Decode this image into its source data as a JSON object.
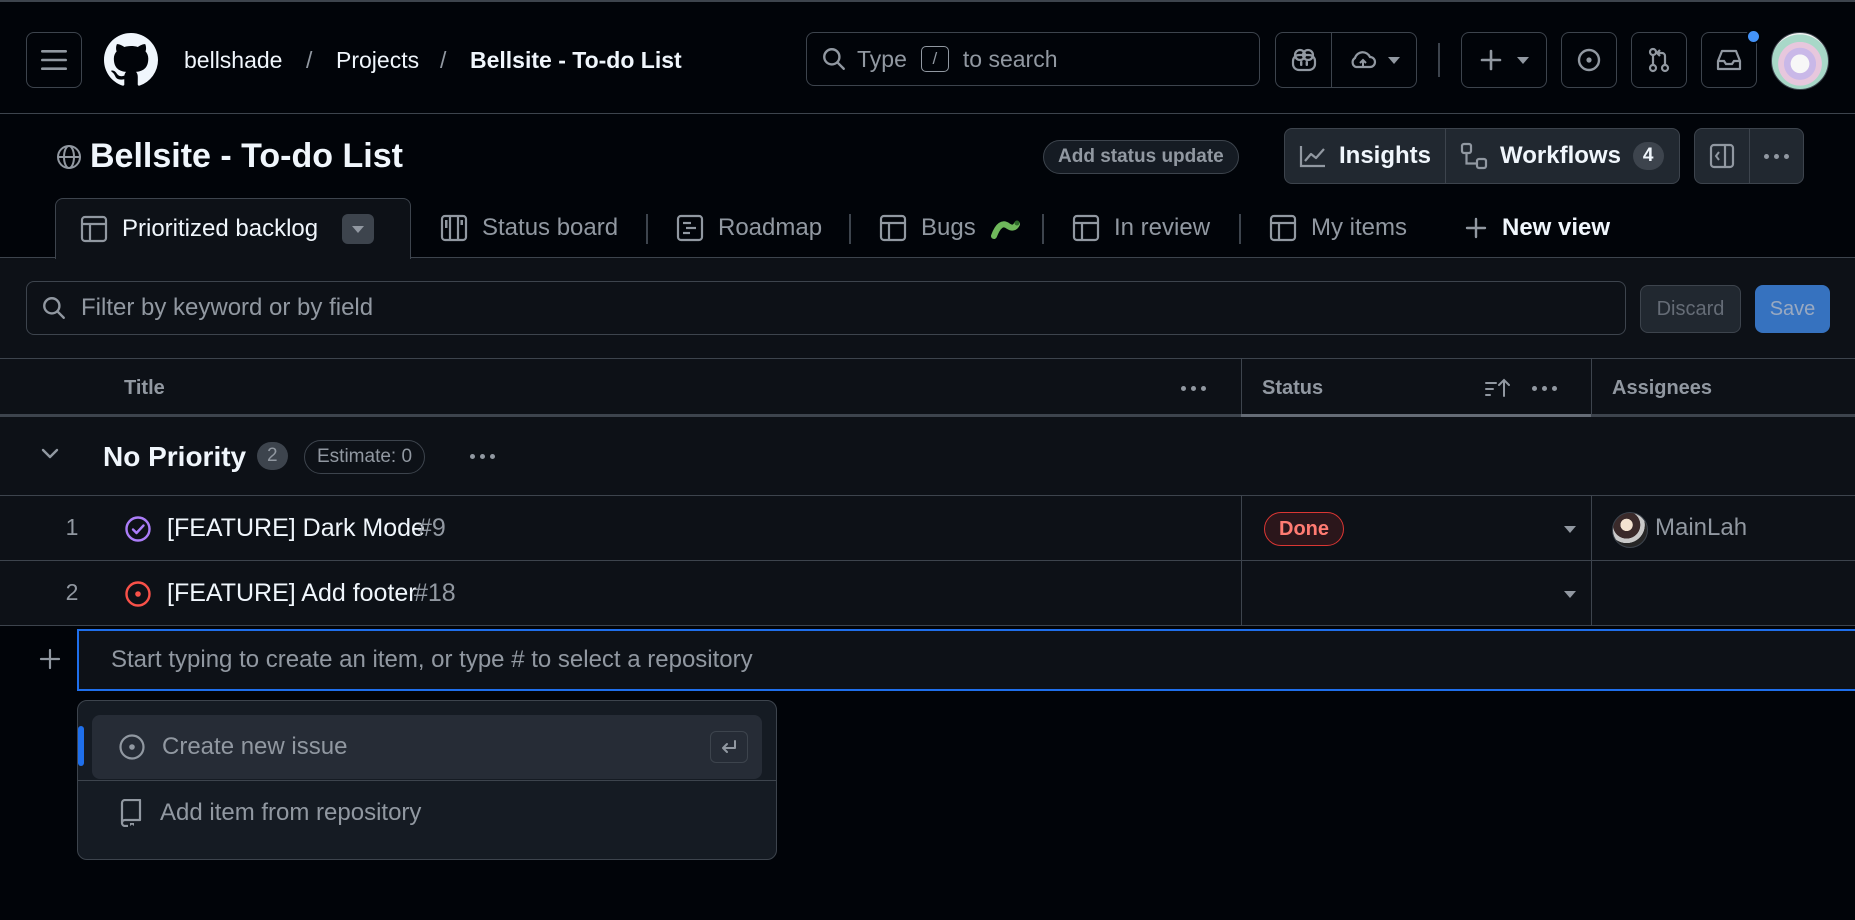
{
  "header": {
    "breadcrumbs": [
      "bellshade",
      "Projects",
      "Bellsite - To-do List"
    ],
    "breadcrumb_separator": "/",
    "search": {
      "prefix": "Type",
      "key": "/",
      "suffix": "to search"
    },
    "notification_dot_color": "#4493f8",
    "icons": [
      "menu-icon",
      "github-logo",
      "search-icon",
      "copilot-icon",
      "cloud-icon",
      "plus-icon",
      "issue-icon",
      "pull-request-icon",
      "inbox-icon"
    ]
  },
  "project": {
    "title": "Bellsite - To-do List",
    "status_update_label": "Add status update",
    "insights_label": "Insights",
    "workflows_label": "Workflows",
    "workflows_count": "4"
  },
  "tabs": [
    {
      "label": "Prioritized backlog",
      "icon": "table-icon",
      "active": true
    },
    {
      "label": "Status board",
      "icon": "board-icon"
    },
    {
      "label": "Roadmap",
      "icon": "roadmap-icon"
    },
    {
      "label": "Bugs",
      "icon": "table-icon",
      "emoji": "🐛"
    },
    {
      "label": "In review",
      "icon": "table-icon"
    },
    {
      "label": "My items",
      "icon": "table-icon"
    },
    {
      "label": "New view",
      "icon": "plus-icon"
    }
  ],
  "filter": {
    "placeholder": "Filter by keyword or by field",
    "discard_label": "Discard",
    "save_label": "Save"
  },
  "table": {
    "columns": [
      "Title",
      "Status",
      "Assignees"
    ],
    "group": {
      "title": "No Priority",
      "count": "2",
      "estimate": "Estimate: 0"
    },
    "rows": [
      {
        "index": "1",
        "title": "[FEATURE] Dark Mode",
        "number": "#9",
        "state": "closed",
        "status": "Done",
        "assignee": "MainLah"
      },
      {
        "index": "2",
        "title": "[FEATURE] Add footer",
        "number": "#18",
        "state": "open",
        "status": "",
        "assignee": ""
      }
    ],
    "new_item_placeholder": "Start typing to create an item, or type # to select a repository"
  },
  "menu": {
    "items": [
      {
        "label": "Create new issue",
        "icon": "issue-icon"
      },
      {
        "label": "Add item from repository",
        "icon": "repo-icon"
      }
    ]
  },
  "colors": {
    "accent": "#1f6feb",
    "done": "#da3633",
    "closed_issue": "#ab7df8",
    "open_issue": "#f85149"
  }
}
